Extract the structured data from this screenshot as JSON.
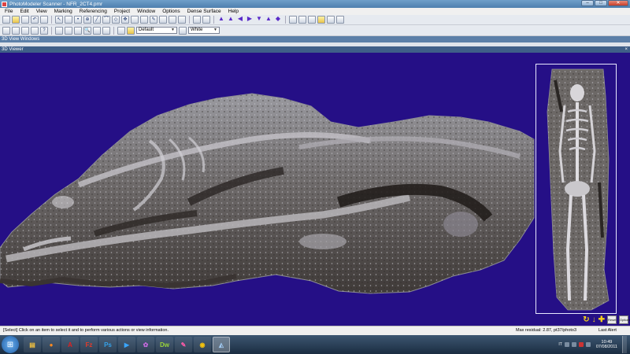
{
  "window": {
    "title": "PhotoModeler Scanner - NFR_2CT4.pmr"
  },
  "menu": [
    "File",
    "Edit",
    "View",
    "Marking",
    "Referencing",
    "Project",
    "Window",
    "Options",
    "Dense Surface",
    "Help"
  ],
  "toolbar": {
    "default_combo": "Default",
    "color_combo": "White"
  },
  "panes": {
    "windows_label": "3D View Windows",
    "viewer_label": "3D Viewer"
  },
  "view_controls": {
    "reset": "Reset",
    "options": "Options"
  },
  "status": {
    "message": "[Select] Click on an item to select it and to perform various actions or view information.",
    "residual": "Max residual: 2.87, pt37/photo3",
    "alert": "Last Alert"
  },
  "taskbar": {
    "apps": [
      "Windows Explorer",
      "Firefox",
      "Adobe Reader",
      "FileZilla",
      "Photoshop",
      "Windows Media Center",
      "Picasa",
      "Dreamweaver",
      "Color Picker",
      "Chrome",
      "PhotoModeler"
    ],
    "language": "IT",
    "time": "10:49",
    "date": "07/08/2011"
  },
  "colors": {
    "viewer_bg": "#250f86",
    "taskbar": "#1f334a"
  }
}
